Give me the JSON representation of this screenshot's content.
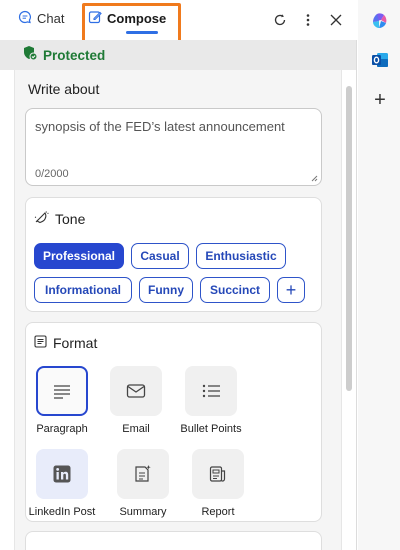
{
  "tabs": {
    "chat": "Chat",
    "compose": "Compose"
  },
  "status": {
    "protected": "Protected"
  },
  "write_about": {
    "label": "Write about",
    "value": "synopsis of the FED’s latest announcement",
    "counter": "0/2000"
  },
  "tone": {
    "title": "Tone",
    "options": [
      "Professional",
      "Casual",
      "Enthusiastic",
      "Informational",
      "Funny",
      "Succinct"
    ],
    "selected": "Professional",
    "add_symbol": "+"
  },
  "format": {
    "title": "Format",
    "options": [
      "Paragraph",
      "Email",
      "Bullet Points",
      "LinkedIn Post",
      "Summary",
      "Report"
    ],
    "selected": "Paragraph"
  },
  "rail": {
    "add_symbol": "+"
  },
  "colors": {
    "accent": "#2747cf",
    "highlight": "#f07a1d",
    "protected_green": "#1f7a36",
    "outlook_blue": "#0f6cbd"
  },
  "icons": [
    "chat-icon",
    "compose-icon",
    "refresh-icon",
    "more-icon",
    "close-icon",
    "shield-check-icon",
    "tone-icon",
    "format-icon",
    "paragraph-icon",
    "email-icon",
    "bullet-list-icon",
    "linkedin-icon",
    "summary-icon",
    "report-icon",
    "copilot-icon",
    "outlook-icon",
    "add-icon"
  ]
}
